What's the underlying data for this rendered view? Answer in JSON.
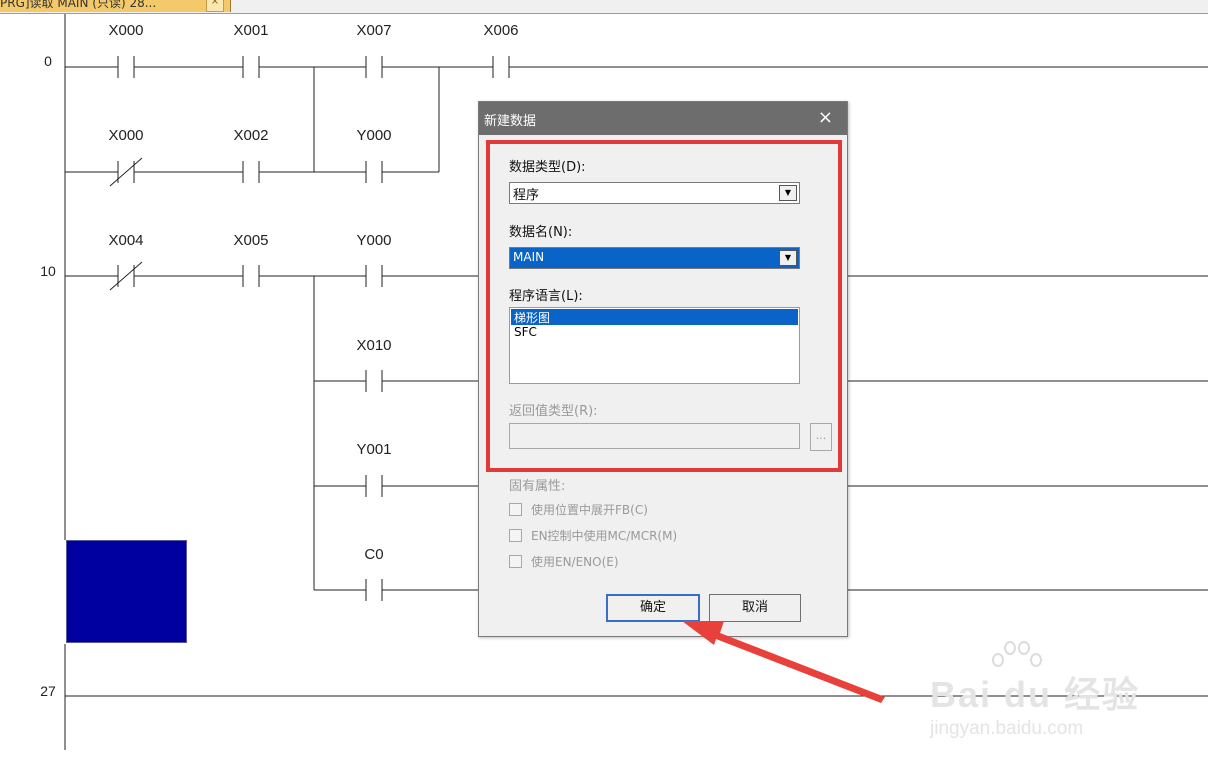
{
  "tab": {
    "title": "PRG]读取 MAIN (只读) 28..."
  },
  "ladder": {
    "step_numbers": [
      "0",
      "10",
      "27"
    ],
    "contacts": [
      {
        "label": "X000"
      },
      {
        "label": "X001"
      },
      {
        "label": "X007"
      },
      {
        "label": "X006"
      },
      {
        "label": "X000"
      },
      {
        "label": "X002"
      },
      {
        "label": "Y000"
      },
      {
        "label": "X004"
      },
      {
        "label": "X005"
      },
      {
        "label": "Y000"
      },
      {
        "label": "X010"
      },
      {
        "label": "Y001"
      },
      {
        "label": "C0"
      }
    ]
  },
  "dialog": {
    "title": "新建数据",
    "data_type_label": "数据类型(D):",
    "data_type_value": "程序",
    "data_name_label": "数据名(N):",
    "data_name_value": "MAIN",
    "program_language_label": "程序语言(L):",
    "program_languages": [
      "梯形图",
      "SFC"
    ],
    "selected_language": "梯形图",
    "return_type_label": "返回值类型(R):",
    "return_type_button": "...",
    "inherent_props_label": "固有属性:",
    "checkboxes": [
      {
        "label": "使用位置中展开FB(C)",
        "checked": false
      },
      {
        "label": "EN控制中使用MC/MCR(M)",
        "checked": false
      },
      {
        "label": "使用EN/ENO(E)",
        "checked": false
      }
    ],
    "ok_label": "确定",
    "cancel_label": "取消"
  },
  "watermark": {
    "brand": "Bai du 经验",
    "url": "jingyan.baidu.com"
  },
  "colors": {
    "highlight_box": "#e23a3a",
    "selection": "#0a64c8",
    "title_bar": "#6d6d6d",
    "block": "#0000a0"
  }
}
